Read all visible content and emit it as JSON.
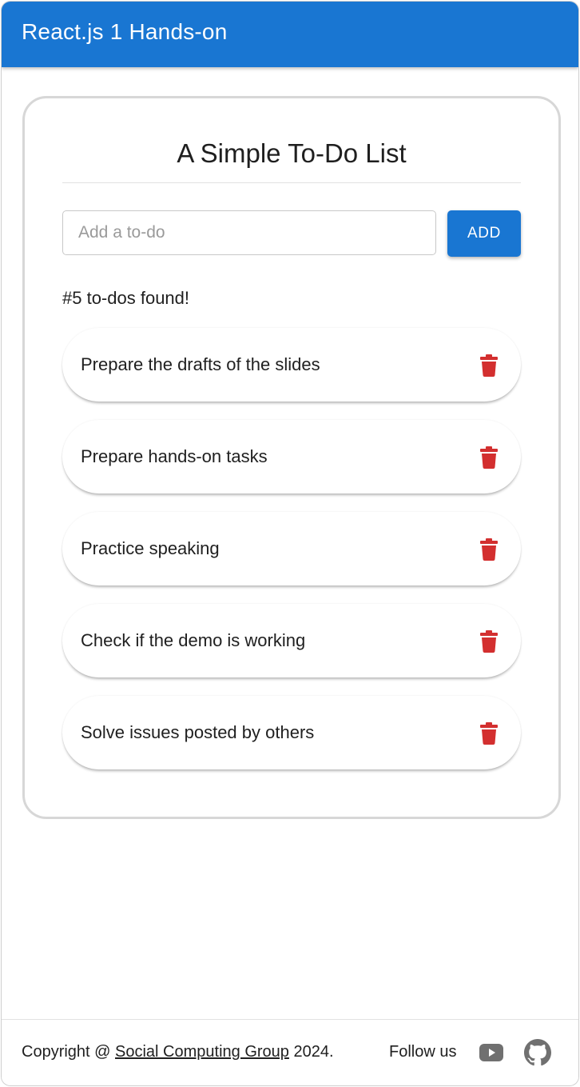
{
  "appbar": {
    "title": "React.js 1 Hands-on",
    "color": "#1976d2"
  },
  "card": {
    "title": "A Simple To-Do List",
    "input": {
      "placeholder": "Add a to-do",
      "value": ""
    },
    "add_label": "ADD",
    "count_text": "#5 to-dos found!",
    "todos": [
      {
        "text": "Prepare the drafts of the slides",
        "icon": "trash-icon"
      },
      {
        "text": "Prepare hands-on tasks",
        "icon": "trash-icon"
      },
      {
        "text": "Practice speaking",
        "icon": "trash-icon"
      },
      {
        "text": "Check if the demo is working",
        "icon": "trash-icon"
      },
      {
        "text": "Solve issues posted by others",
        "icon": "trash-icon"
      }
    ],
    "delete_color": "#d32f2f"
  },
  "footer": {
    "copyright_prefix": "Copyright @ ",
    "link_text": "Social Computing Group",
    "copyright_suffix": " 2024.",
    "follow_label": "Follow us",
    "icons": [
      "youtube-icon",
      "github-icon"
    ]
  }
}
